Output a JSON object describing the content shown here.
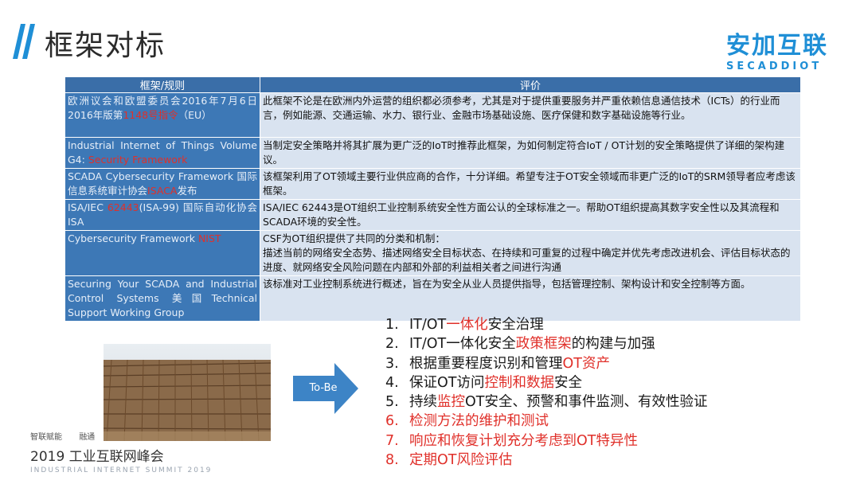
{
  "header": {
    "title": "框架对标",
    "logo_cn": "安加互联",
    "logo_en": "SECADDIOT"
  },
  "table": {
    "headers": [
      "框架/规则",
      "评价"
    ],
    "rows": [
      {
        "framework_pre": "欧洲议会和欧盟委员会2016年7月6日2016年版第",
        "framework_hl": "1148号指令",
        "framework_post": "（EU）",
        "review": "此框架不论是在欧洲内外运营的组织都必须参考，尤其是对于提供重要服务并严重依赖信息通信技术（ICTs）的行业而言，例如能源、交通运输、水力、银行业、金融市场基础设施、医疗保健和数字基础设施等行业。"
      },
      {
        "framework_pre": "Industrial Internet of Things Volume G4: ",
        "framework_hl": "Security Framework",
        "framework_post": "",
        "review": "当制定安全策略并将其扩展为更广泛的IoT时推荐此框架，为如何制定符合IoT / OT计划的安全策略提供了详细的架构建议。"
      },
      {
        "framework_pre": "SCADA Cybersecurity Framework 国际信息系统审计协会",
        "framework_hl": "ISACA",
        "framework_post": "发布",
        "review": "该框架利用了OT领域主要行业供应商的合作，十分详细。希望专注于OT安全领域而非更广泛的IoT的SRM领导者应考虑该框架。"
      },
      {
        "framework_pre": "ISA/IEC ",
        "framework_hl": "62443",
        "framework_post": "(ISA-99) 国际自动化协会ISA",
        "review": "ISA/IEC 62443是OT组织工业控制系统安全性方面公认的全球标准之一。帮助OT组织提高其数字安全性以及其流程和SCADA环境的安全性。"
      },
      {
        "framework_pre": "Cybersecurity Framework ",
        "framework_hl": "NIST",
        "framework_post": "",
        "review": "CSF为OT组织提供了共同的分类和机制：\n描述当前的网络安全态势、描述网络安全目标状态、在持续和可重复的过程中确定并优先考虑改进机会、评估目标状态的进度、就网络安全风险问题在内部和外部的利益相关者之间进行沟通"
      },
      {
        "framework_pre": "Securing Your SCADA and Industrial Control Systems 美国Technical Support Working Group",
        "framework_hl": "",
        "framework_post": "",
        "review": "该标准对工业控制系统进行概述，旨在为安全从业人员提供指导，包括管理控制、架构设计和安全控制等方面。"
      }
    ]
  },
  "arrow_label": "To-Be",
  "steps": [
    {
      "num": "1.",
      "parts": [
        [
          "IT/OT",
          false
        ],
        [
          "一体化",
          true
        ],
        [
          "安全治理",
          false
        ]
      ],
      "red": false
    },
    {
      "num": "2.",
      "parts": [
        [
          "IT/OT一体化安全",
          false
        ],
        [
          "政策框架",
          true
        ],
        [
          "的构建与加强",
          false
        ]
      ],
      "red": false
    },
    {
      "num": "3.",
      "parts": [
        [
          "根据重要程度识别和管理",
          false
        ],
        [
          "OT资产",
          true
        ]
      ],
      "red": false
    },
    {
      "num": "4.",
      "parts": [
        [
          "保证OT访问",
          false
        ],
        [
          "控制和数据",
          true
        ],
        [
          "安全",
          false
        ]
      ],
      "red": false
    },
    {
      "num": "5.",
      "parts": [
        [
          "持续",
          false
        ],
        [
          "监控",
          true
        ],
        [
          "OT安全、预警和事件监测、有效性验证",
          false
        ]
      ],
      "red": false
    },
    {
      "num": "6.",
      "parts": [
        [
          "检测",
          true
        ],
        [
          "方法的维护和测试",
          false
        ]
      ],
      "red": true
    },
    {
      "num": "7.",
      "parts": [
        [
          "响应和恢复",
          true
        ],
        [
          "计划充分考虑到OT特异性",
          false
        ]
      ],
      "red": true
    },
    {
      "num": "8.",
      "parts": [
        [
          "定期",
          true
        ],
        [
          "OT风险评估",
          false
        ]
      ],
      "red": true
    }
  ],
  "footer": {
    "badge1": "智联赋能",
    "badge2": "融通",
    "title": "2019 工业互联网峰会",
    "subtitle": "INDUSTRIAL INTERNET SUMMIT 2019"
  },
  "colors": {
    "accent": "#1f8fd6",
    "table_header": "#3a6ea8",
    "left_cell": "#3d78b6",
    "right_cell": "#d9e3f0",
    "highlight": "#e0302a"
  }
}
